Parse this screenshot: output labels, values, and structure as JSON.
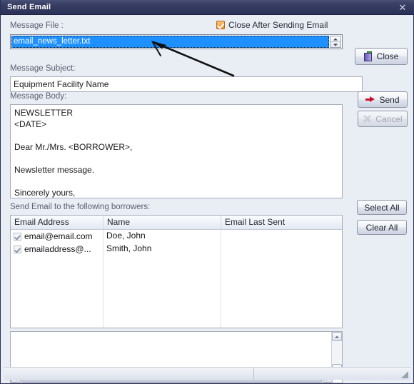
{
  "window": {
    "title": "Send Email",
    "close_icon": "close-x-icon"
  },
  "form": {
    "message_file_label": "Message File :",
    "message_file_value": "email_news_letter.txt",
    "message_subject_label": "Message Subject:",
    "message_subject_value": "Equipment Facility Name",
    "message_body_label": "Message Body:",
    "message_body_value": "NEWSLETTER\n<DATE>\n\nDear Mr./Mrs. <BORROWER>,\n\nNewsletter message.\n\nSincerely yours,",
    "close_after_sending_label": "Close After Sending Email",
    "close_after_sending_checked": true,
    "borrowers_label": "Send Email to the following borrowers:"
  },
  "buttons": {
    "close": "Close",
    "send": "Send",
    "cancel": "Cancel",
    "cancel_disabled": true,
    "select_all": "Select All",
    "clear_all": "Clear All"
  },
  "grid": {
    "columns": [
      "Email Address",
      "Name",
      "Email Last Sent"
    ],
    "rows": [
      {
        "checked": true,
        "email": "email@email.com",
        "name": "Doe, John",
        "last_sent": ""
      },
      {
        "checked": true,
        "email": "emailaddress@...",
        "name": "Smith, John",
        "last_sent": ""
      }
    ],
    "empty_rows": 6
  },
  "log": {
    "value": ""
  },
  "statusbar": {
    "panel_1": "",
    "panel_2": ""
  },
  "colors": {
    "titlebar": "#333a5e",
    "selection": "#1e90ff",
    "checkbox_accent": "#f09226",
    "send_arrow": "#c9102a",
    "annotation": "#111111"
  }
}
